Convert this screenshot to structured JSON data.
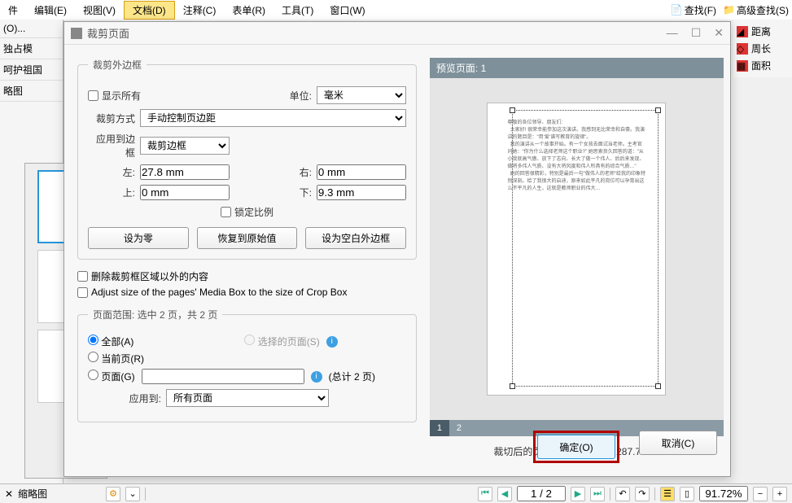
{
  "menu": {
    "items": [
      "件",
      "编辑(E)",
      "视图(V)",
      "文档(D)",
      "注释(C)",
      "表单(R)",
      "工具(T)",
      "窗口(W)"
    ],
    "active": 3,
    "right": [
      "查找(F)",
      "高级查找(S)"
    ]
  },
  "rtools": [
    "距离",
    "周长",
    "面积"
  ],
  "left": {
    "labels": [
      "(O)...",
      "独占模",
      "呵护祖国",
      "略图"
    ],
    "tab": "缩略图"
  },
  "dialog": {
    "title": "裁剪页面",
    "crop_group": "裁剪外边框",
    "show_all": "显示所有",
    "unit_label": "单位:",
    "unit_value": "毫米",
    "crop_mode_label": "裁剪方式",
    "crop_mode_value": "手动控制页边距",
    "apply_border_label": "应用到边框",
    "apply_border_value": "裁剪边框",
    "left_label": "左:",
    "left_val": "27.8 mm",
    "right_label": "右:",
    "right_val": "0 mm",
    "top_label": "上:",
    "top_val": "0 mm",
    "bottom_label": "下:",
    "bottom_val": "9.3 mm",
    "lock_ratio": "锁定比例",
    "set_zero": "设为零",
    "restore": "恢复到原始值",
    "set_blank": "设为空白外边框",
    "delete_outside": "删除裁剪框区域以外的内容",
    "adjust_media": "Adjust size of the pages' Media Box to the size of Crop Box",
    "range_title": "页面范围: 选中 2 页，共 2 页",
    "all": "全部(A)",
    "selected": "选择的页面(S)",
    "current": "当前页(R)",
    "pages": "页面(G)",
    "total_pages": "(总计 2 页)",
    "apply_to_label": "应用到:",
    "apply_to_value": "所有页面",
    "preview": "预览页面: 1",
    "size_after": "裁切后的页面大小：182.2 x 287.7 mm",
    "ok": "确定(O)",
    "cancel": "取消(C)"
  },
  "status": {
    "tab": "缩略图",
    "page": "1 / 2",
    "zoom": "91.72%"
  },
  "chart_data": null
}
